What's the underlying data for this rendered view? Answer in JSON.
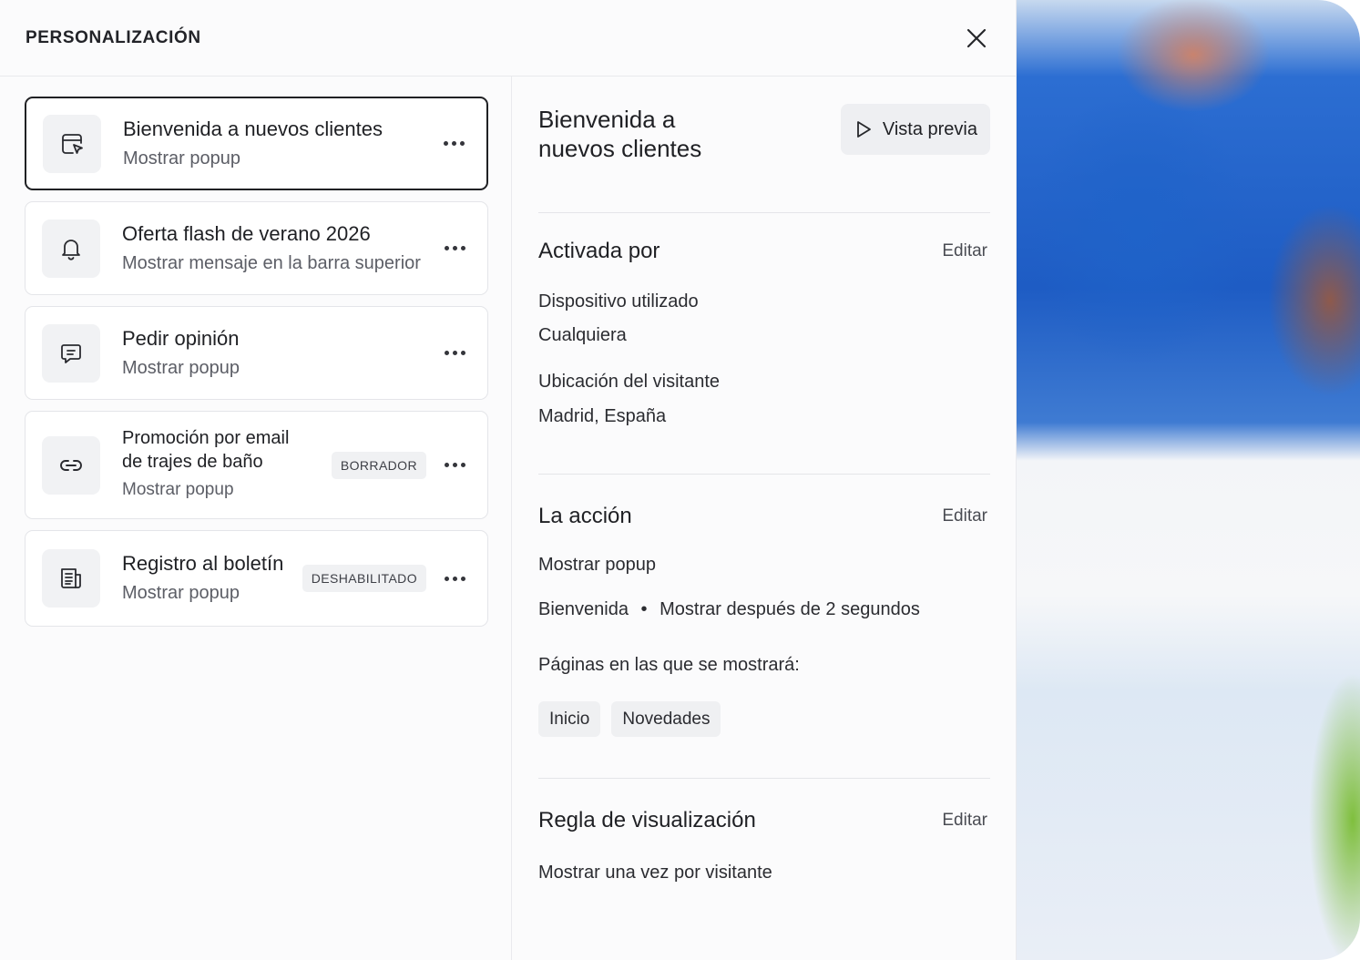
{
  "header": {
    "title": "PERSONALIZACIÓN"
  },
  "list": [
    {
      "title": "Bienvenida a nuevos clientes",
      "subtitle": "Mostrar popup",
      "badge": "",
      "icon": "browser-cursor-icon",
      "active": true
    },
    {
      "title": "Oferta flash de verano 2026",
      "subtitle": "Mostrar mensaje en la barra superior",
      "badge": "",
      "icon": "bell-icon",
      "active": false
    },
    {
      "title": "Pedir opinión",
      "subtitle": "Mostrar popup",
      "badge": "",
      "icon": "chat-icon",
      "active": false
    },
    {
      "title_line1": "Promoción por email",
      "title_line2": "de trajes de baño",
      "subtitle": "Mostrar popup",
      "badge": "BORRADOR",
      "icon": "link-icon",
      "active": false
    },
    {
      "title": "Registro al boletín",
      "subtitle": "Mostrar popup",
      "badge": "DESHABILITADO",
      "icon": "newsletter-icon",
      "active": false
    }
  ],
  "detail": {
    "title_line1": "Bienvenida a",
    "title_line2": "nuevos clientes",
    "preview_label": "Vista previa",
    "trigger": {
      "title": "Activada por",
      "edit": "Editar",
      "device_label": "Dispositivo utilizado",
      "device_value": "Cualquiera",
      "location_label": "Ubicación del visitante",
      "location_value": "Madrid, España"
    },
    "action": {
      "title": "La acción",
      "edit": "Editar",
      "type": "Mostrar popup",
      "popup_name": "Bienvenida",
      "separator": "•",
      "delay": "Mostrar después de 2 segundos",
      "pages_label": "Páginas en las que se mostrará:",
      "pages": [
        "Inicio",
        "Novedades"
      ]
    },
    "display_rule": {
      "title": "Regla de visualización",
      "edit": "Editar",
      "value": "Mostrar una vez por visitante"
    }
  },
  "colors": {
    "panel_bg": "#fbfbfc",
    "card_border_active": "#202124",
    "chip_bg": "#eff0f2"
  }
}
